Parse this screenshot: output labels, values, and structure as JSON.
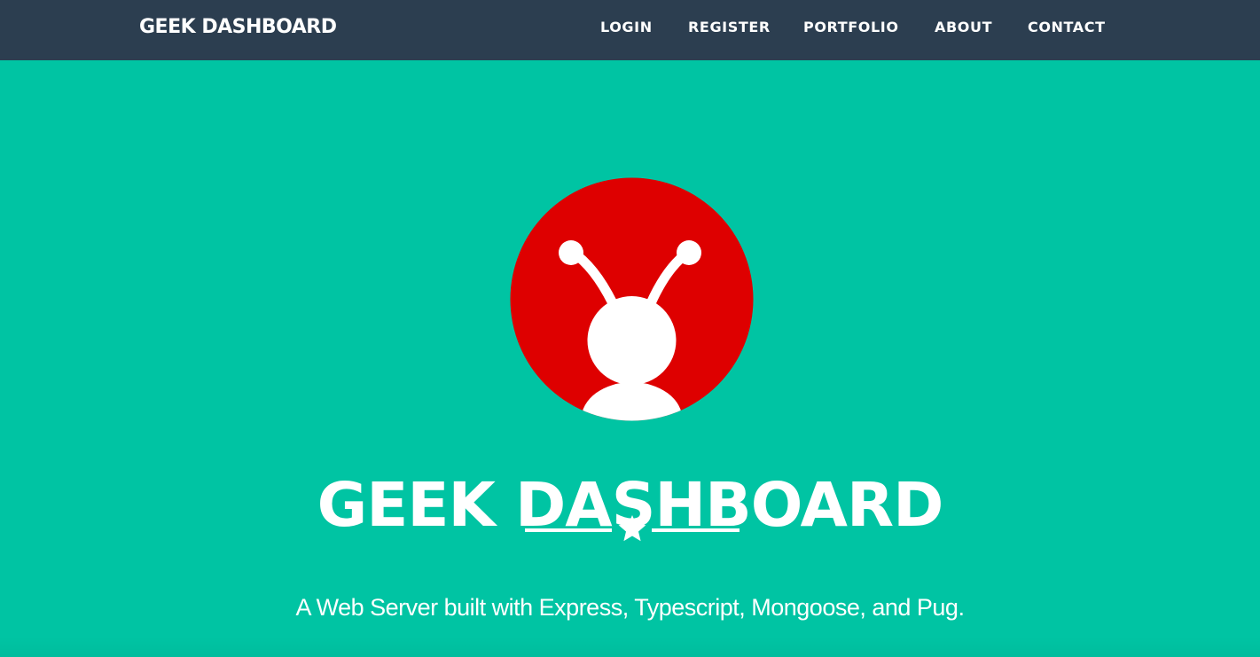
{
  "navbar": {
    "brand": "GEEK DASHBOARD",
    "items": [
      {
        "label": "LOGIN"
      },
      {
        "label": "REGISTER"
      },
      {
        "label": "PORTFOLIO"
      },
      {
        "label": "ABOUT"
      },
      {
        "label": "CONTACT"
      }
    ]
  },
  "hero": {
    "logo_icon": "bug-avatar-icon",
    "title": "GEEK DASHBOARD",
    "divider_icon": "star-icon",
    "subtitle": "A Web Server built with Express, Typescript, Mongoose, and Pug."
  },
  "colors": {
    "navbar_bg": "#2c3e50",
    "hero_bg": "#00c4a3",
    "logo_red": "#de0000",
    "text": "#ffffff"
  }
}
